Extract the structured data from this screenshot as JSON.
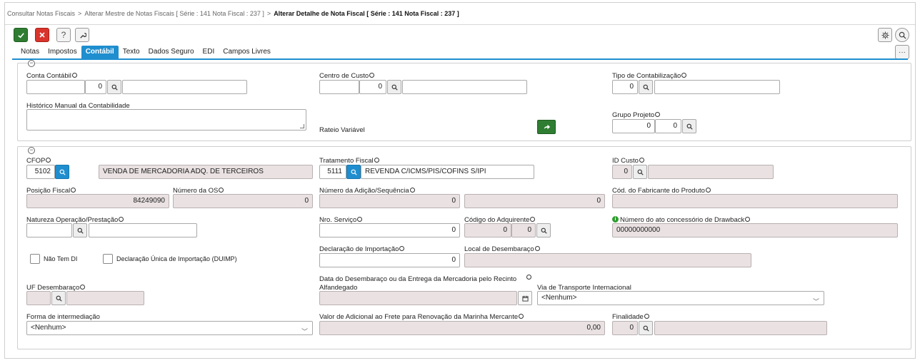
{
  "breadcrumb": {
    "items": [
      "Consultar Notas Fiscais",
      "Alterar Mestre de Notas Fiscais [ Série : 141 Nota Fiscal : 237 ]"
    ],
    "current": "Alterar Detalhe de Nota Fiscal [ Série : 141 Nota Fiscal : 237 ]",
    "separator": ">"
  },
  "toolbar": {
    "ok_icon": "check-icon",
    "cancel_icon": "close-icon",
    "help_label": "?",
    "tool_icon": "wrench-icon",
    "more_label": "···"
  },
  "tabs": [
    {
      "label": "Notas"
    },
    {
      "label": "Impostos"
    },
    {
      "label": "Contábil",
      "active": true
    },
    {
      "label": "Texto"
    },
    {
      "label": "Dados Seguro"
    },
    {
      "label": "EDI"
    },
    {
      "label": "Campos Livres"
    }
  ],
  "contabil": {
    "conta_contabil": {
      "label": "Conta Contábil",
      "code": "",
      "value": "0",
      "description": ""
    },
    "centro_custo": {
      "label": "Centro de Custo",
      "code": "",
      "value": "0",
      "description": ""
    },
    "tipo_contabilizacao": {
      "label": "Tipo de Contabilização",
      "value": "0",
      "description": ""
    },
    "historico": {
      "label": "Histórico Manual da Contabilidade",
      "value": ""
    },
    "rateio": {
      "label": "Rateio Variável"
    },
    "grupo_projeto": {
      "label": "Grupo Projeto",
      "value1": "0",
      "value2": "0"
    }
  },
  "fiscal": {
    "cfop": {
      "label": "CFOP",
      "code": "5102",
      "description": "VENDA DE MERCADORIA ADQ. DE TERCEIROS"
    },
    "tratamento_fiscal": {
      "label": "Tratamento Fiscal",
      "code": "5111",
      "description": "REVENDA C/ICMS/PIS/COFINS S/IPI"
    },
    "id_custo": {
      "label": "ID Custo",
      "value": "0",
      "description": ""
    },
    "posicao_fiscal": {
      "label": "Posição Fiscal",
      "value": "84249090"
    },
    "numero_os": {
      "label": "Número da OS",
      "value": "0"
    },
    "numero_adicao": {
      "label": "Número da Adição/Sequência",
      "value1": "0",
      "value2": "0"
    },
    "cod_fabricante": {
      "label": "Cód. do Fabricante do Produto",
      "value": ""
    },
    "natureza_operacao": {
      "label": "Natureza Operação/Prestação",
      "code": "",
      "description": ""
    },
    "nro_servico": {
      "label": "Nro. Serviço",
      "value": "0"
    },
    "codigo_adquirente": {
      "label": "Código do Adquirente",
      "value1": "0",
      "value2": "0"
    },
    "ato_drawback": {
      "label": "Número do ato concessório de Drawback",
      "value": "00000000000"
    },
    "nao_tem_di": {
      "label": "Não Tem DI"
    },
    "duimp": {
      "label": "Declaração Única de Importação (DUIMP)"
    },
    "declaracao_importacao": {
      "label": "Declaração de Importação",
      "value": "0"
    },
    "local_desembaraco": {
      "label": "Local de Desembaraço",
      "value": ""
    },
    "uf_desembaraco": {
      "label": "UF Desembaraço",
      "code": "",
      "description": ""
    },
    "data_desembaraco": {
      "label_line1": "Data do Desembaraço ou da Entrega da Mercadoria pelo Recinto",
      "label_line2": "Alfandegado",
      "value": ""
    },
    "via_transporte": {
      "label": "Via de Transporte Internacional",
      "value": "<Nenhum>"
    },
    "forma_intermediacao": {
      "label": "Forma de intermediação",
      "value": "<Nenhum>"
    },
    "valor_adicional_frete": {
      "label": "Valor de Adicional ao Frete para Renovação da Marinha Mercante",
      "value": "0,00"
    },
    "finalidade": {
      "label": "Finalidade",
      "value": "0",
      "description": ""
    }
  }
}
